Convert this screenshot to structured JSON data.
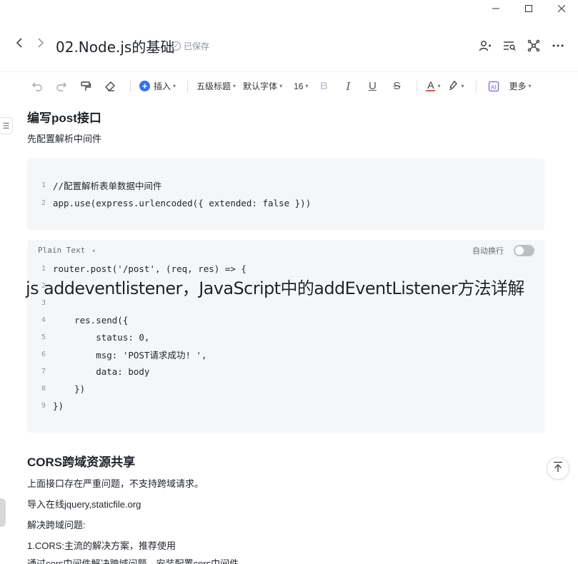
{
  "window": {
    "minimize_icon": "minimize-icon",
    "maximize_icon": "maximize-icon",
    "close_icon": "close-icon"
  },
  "header": {
    "title": "02.Node.js的基础",
    "saved_status": "已保存"
  },
  "toolbar": {
    "insert_label": "插入",
    "heading_label": "五级标题",
    "font_label": "默认字体",
    "size_label": "16",
    "more_label": "更多",
    "accent_color": "#3370ff",
    "font_color": "#f54a45"
  },
  "content": {
    "heading_post": "编写post接口",
    "para_middleware": "先配置解析中间件",
    "code1": {
      "lines": [
        {
          "n": "1",
          "text": "//配置解析表单数据中间件"
        },
        {
          "n": "2",
          "text": "app.use(express.urlencoded({ extended: false }))"
        }
      ]
    },
    "code2": {
      "language": "Plain Text",
      "wrap_label": "自动换行",
      "lines": [
        {
          "n": "1",
          "text": "router.post('/post', (req, res) => {"
        },
        {
          "n": "2",
          "text": ""
        },
        {
          "n": "3",
          "text": ""
        },
        {
          "n": "4",
          "text": "    res.send({"
        },
        {
          "n": "5",
          "text": "        status: 0,"
        },
        {
          "n": "6",
          "text": "        msg: 'POST请求成功! ',"
        },
        {
          "n": "7",
          "text": "        data: body"
        },
        {
          "n": "8",
          "text": "    })"
        },
        {
          "n": "9",
          "text": "})"
        }
      ]
    },
    "watermark": "js addeventlistener，JavaScript中的addEventListener方法详解",
    "heading_cors": "CORS跨域资源共享",
    "paras": [
      "上面接口存在严重问题，不支持跨域请求。",
      "导入在线jquery,staticfile.org",
      "解决跨域问题:",
      "1.CORS:主流的解决方案，推荐使用"
    ],
    "cut_line": "通过cors中间件解决跨域问题，安装配置cors中间件"
  }
}
